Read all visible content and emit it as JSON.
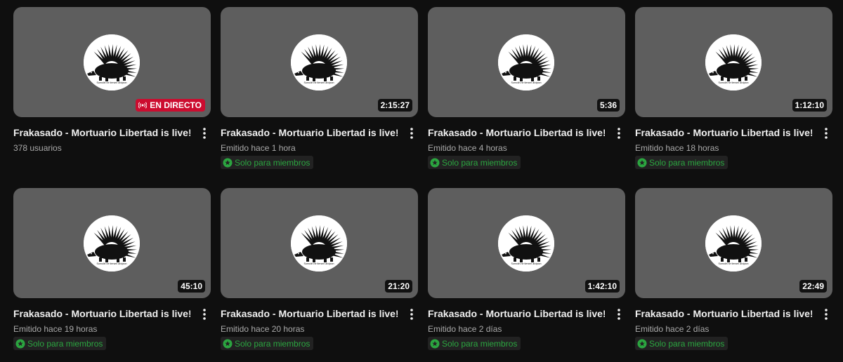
{
  "videos": [
    {
      "title": "Frakasado - Mortuario Libertad is live!",
      "meta": "378 usuarios",
      "badge_type": "live",
      "badge": "EN DIRECTO",
      "members": "",
      "avatar_caption": "Sumolin ne tiersen alvipion"
    },
    {
      "title": "Frakasado - Mortuario Libertad is live!",
      "meta": "Emitido hace 1 hora",
      "badge_type": "duration",
      "badge": "2:15:27",
      "members": "Solo para miembros",
      "avatar_caption": "Sumolin ne tiersen alvipion"
    },
    {
      "title": "Frakasado - Mortuario Libertad is live!",
      "meta": "Emitido hace 4 horas",
      "badge_type": "duration",
      "badge": "5:36",
      "members": "Solo para miembros",
      "avatar_caption": "Sumolin ne tiersen alvipion"
    },
    {
      "title": "Frakasado - Mortuario Libertad is live!",
      "meta": "Emitido hace 18 horas",
      "badge_type": "duration",
      "badge": "1:12:10",
      "members": "Solo para miembros",
      "avatar_caption": "Sumolin ne tiersen alvipion"
    },
    {
      "title": "Frakasado - Mortuario Libertad is live!",
      "meta": "Emitido hace 19 horas",
      "badge_type": "duration",
      "badge": "45:10",
      "members": "Solo para miembros",
      "avatar_caption": "Sumolin ne tiersen alvipion"
    },
    {
      "title": "Frakasado - Mortuario Libertad is live!",
      "meta": "Emitido hace 20 horas",
      "badge_type": "duration",
      "badge": "21:20",
      "members": "Solo para miembros",
      "avatar_caption": "Sumolin ne tiersen alvipion"
    },
    {
      "title": "Frakasado - Mortuario Libertad is live!",
      "meta": "Emitido hace 2 días",
      "badge_type": "duration",
      "badge": "1:42:10",
      "members": "Solo para miembros",
      "avatar_caption": "Sumolin ne tiersen alvipion"
    },
    {
      "title": "Frakasado - Mortuario Libertad is live!",
      "meta": "Emitido hace 2 días",
      "badge_type": "duration",
      "badge": "22:49",
      "members": "Solo para miembros",
      "avatar_caption": "Sumolin ne tiersen alvipion"
    }
  ],
  "icons": {
    "thumbnail_logo": "porcupine-logo-icon",
    "live": "live-broadcast-icon",
    "menu": "more-vert-icon",
    "members": "members-star-icon"
  },
  "colors": {
    "background": "#0f0f0f",
    "thumbnail": "#5e5e5e",
    "live_badge": "#cc0c2f",
    "members_text": "#2ba640",
    "meta_text": "#aaaaaa"
  }
}
